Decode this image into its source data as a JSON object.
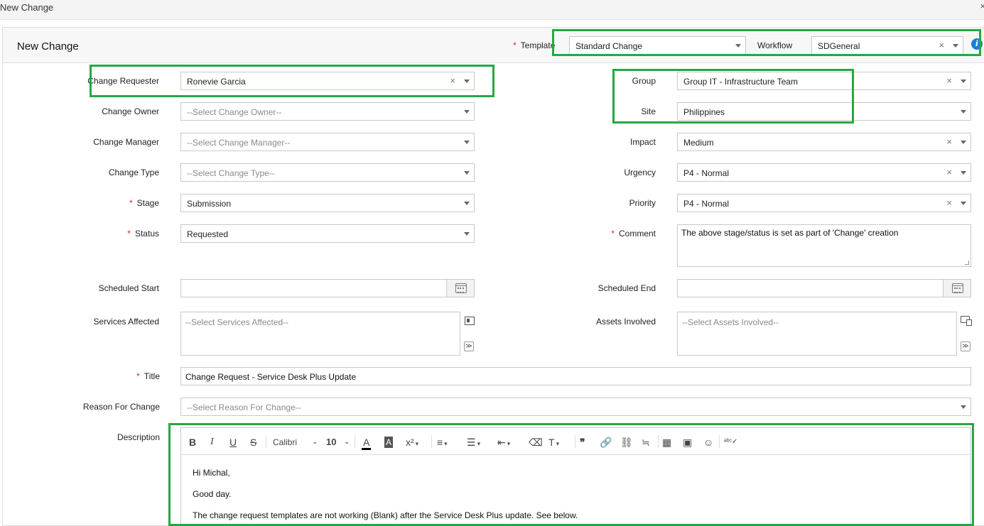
{
  "window": {
    "title": "New Change",
    "close": "×"
  },
  "panel": {
    "title": "New Change"
  },
  "header": {
    "template_label": "Template",
    "template_value": "Standard Change",
    "workflow_label": "Workflow",
    "workflow_value": "SDGeneral",
    "info": "i"
  },
  "left": {
    "requester": {
      "label": "Change Requester",
      "value": "Ronevie Garcia"
    },
    "owner": {
      "label": "Change Owner",
      "placeholder": "--Select Change Owner--"
    },
    "manager": {
      "label": "Change Manager",
      "placeholder": "--Select Change Manager--"
    },
    "type": {
      "label": "Change Type",
      "placeholder": "--Select Change Type--"
    },
    "stage": {
      "label": "Stage",
      "value": "Submission"
    },
    "status": {
      "label": "Status",
      "value": "Requested"
    },
    "scheduled_start": {
      "label": "Scheduled Start",
      "value": ""
    },
    "services": {
      "label": "Services Affected",
      "placeholder": "--Select Services Affected--"
    }
  },
  "right": {
    "group": {
      "label": "Group",
      "value": "Group IT - Infrastructure Team"
    },
    "site": {
      "label": "Site",
      "value": "Philippines"
    },
    "impact": {
      "label": "Impact",
      "value": "Medium"
    },
    "urgency": {
      "label": "Urgency",
      "value": "P4 - Normal"
    },
    "priority": {
      "label": "Priority",
      "value": "P4 - Normal"
    },
    "comment": {
      "label": "Comment",
      "value": "The above stage/status is set as part of 'Change' creation"
    },
    "scheduled_end": {
      "label": "Scheduled End",
      "value": ""
    },
    "assets": {
      "label": "Assets Involved",
      "placeholder": "--Select Assets Involved--"
    }
  },
  "full": {
    "title": {
      "label": "Title",
      "value": "Change Request - Service Desk Plus Update"
    },
    "reason": {
      "label": "Reason For Change",
      "placeholder": "--Select Reason For Change--"
    },
    "description": {
      "label": "Description"
    }
  },
  "editor": {
    "font_family": "Calibri",
    "font_size": "10",
    "lines": [
      "Hi Michal,",
      "Good day.",
      "The change request templates are not working (Blank) after the Service Desk Plus update. See below."
    ]
  },
  "glyphs": {
    "required": "*",
    "clear": "×",
    "collapse": "≫"
  },
  "colors": {
    "highlight": "#26a744",
    "required": "#d9251c",
    "info": "#1a7fd6"
  }
}
